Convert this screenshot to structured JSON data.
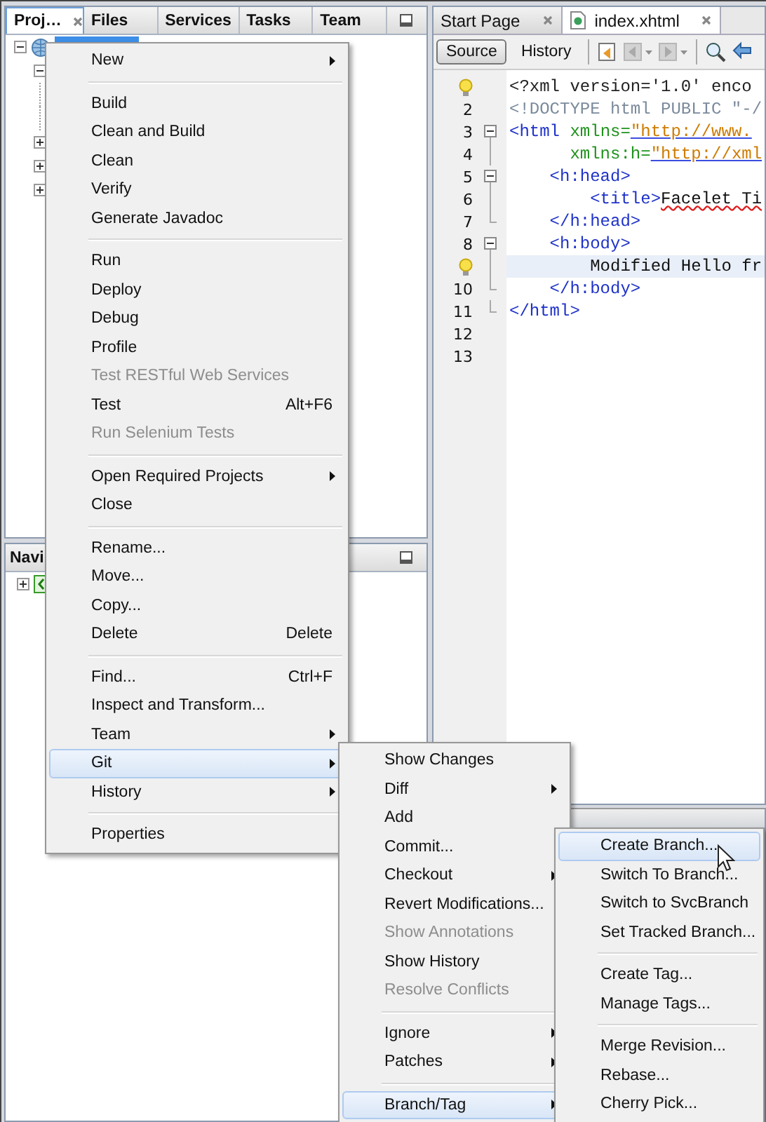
{
  "projects_panel": {
    "tabs": [
      {
        "label": "Proj…",
        "selected": true,
        "closable": true
      },
      {
        "label": "Files",
        "selected": false,
        "closable": false
      },
      {
        "label": "Services",
        "selected": false,
        "closable": false
      },
      {
        "label": "Tasks",
        "selected": false,
        "closable": false
      },
      {
        "label": "Team",
        "selected": false,
        "closable": false
      }
    ],
    "tree": [
      {
        "expanded": true,
        "selected": true,
        "children": [
          {
            "expanded": true,
            "children": [
              {
                "kind": "leaf"
              },
              {
                "kind": "leaf"
              }
            ]
          },
          {
            "expanded": false
          },
          {
            "expanded": false
          },
          {
            "expanded": false
          }
        ]
      }
    ]
  },
  "navigator_panel": {
    "title": "Navi",
    "tree": [
      {
        "expanded": false
      }
    ]
  },
  "editor": {
    "tabs": [
      {
        "label": "Start Page",
        "selected": false,
        "file_icon": false
      },
      {
        "label": "index.xhtml",
        "selected": true,
        "file_icon": true
      }
    ],
    "views": [
      {
        "label": "Source",
        "selected": true
      },
      {
        "label": "History",
        "selected": false
      }
    ],
    "lines": [
      {
        "hint": true,
        "kind": "plain",
        "current": false,
        "segments": [
          {
            "kind": "pi",
            "text": "<?xml version='1.0' enco"
          }
        ]
      },
      {
        "number": "2",
        "hint": false,
        "kind": "plain",
        "current": false,
        "segments": [
          {
            "kind": "doctype",
            "text": "<!DOCTYPE html PUBLIC \"-/"
          }
        ]
      },
      {
        "number": "3",
        "hint": false,
        "kind": "fold-start",
        "current": false,
        "segments": [
          {
            "kind": "tag",
            "text": "<html "
          },
          {
            "kind": "attr",
            "text": "xmlns="
          },
          {
            "kind": "string",
            "text": "\"http://www."
          }
        ]
      },
      {
        "number": "4",
        "hint": false,
        "kind": "fold-line",
        "current": false,
        "segments": [
          {
            "kind": "attr",
            "text": "      xmlns:h="
          },
          {
            "kind": "string",
            "text": "\"http://xml"
          }
        ]
      },
      {
        "number": "5",
        "hint": false,
        "kind": "fold-start",
        "current": false,
        "segments": [
          {
            "kind": "tag",
            "text": "    <h:head>"
          }
        ]
      },
      {
        "number": "6",
        "hint": false,
        "kind": "fold-line",
        "current": false,
        "segments": [
          {
            "kind": "tag",
            "text": "        <title>"
          },
          {
            "kind": "misspelled",
            "text": "Facelet Ti"
          }
        ]
      },
      {
        "number": "7",
        "hint": false,
        "kind": "fold-end",
        "current": false,
        "segments": [
          {
            "kind": "tag",
            "text": "    </h:head>"
          }
        ]
      },
      {
        "number": "8",
        "hint": false,
        "kind": "fold-start",
        "current": false,
        "segments": [
          {
            "kind": "tag",
            "text": "    <h:body>"
          }
        ]
      },
      {
        "hint": true,
        "kind": "fold-line",
        "current": true,
        "segments": [
          {
            "kind": "text",
            "text": "        Modified Hello fr"
          }
        ]
      },
      {
        "number": "10",
        "hint": false,
        "kind": "fold-end",
        "current": false,
        "segments": [
          {
            "kind": "tag",
            "text": "    </h:body>"
          }
        ]
      },
      {
        "number": "11",
        "hint": false,
        "kind": "fold-end",
        "current": false,
        "segments": [
          {
            "kind": "tag",
            "text": "</html>"
          }
        ]
      },
      {
        "number": "12",
        "hint": false,
        "kind": "plain",
        "current": false
      },
      {
        "number": "13",
        "hint": false,
        "kind": "plain",
        "current": false
      }
    ]
  },
  "context_menu": {
    "items": [
      {
        "kind": "item",
        "label": "New",
        "submenu": true,
        "disabled": false,
        "selected": false
      },
      {
        "kind": "separator"
      },
      {
        "kind": "item",
        "label": "Build",
        "submenu": false,
        "disabled": false,
        "selected": false
      },
      {
        "kind": "item",
        "label": "Clean and Build",
        "submenu": false,
        "disabled": false,
        "selected": false
      },
      {
        "kind": "item",
        "label": "Clean",
        "submenu": false,
        "disabled": false,
        "selected": false
      },
      {
        "kind": "item",
        "label": "Verify",
        "submenu": false,
        "disabled": false,
        "selected": false
      },
      {
        "kind": "item",
        "label": "Generate Javadoc",
        "submenu": false,
        "disabled": false,
        "selected": false
      },
      {
        "kind": "separator"
      },
      {
        "kind": "item",
        "label": "Run",
        "submenu": false,
        "disabled": false,
        "selected": false
      },
      {
        "kind": "item",
        "label": "Deploy",
        "submenu": false,
        "disabled": false,
        "selected": false
      },
      {
        "kind": "item",
        "label": "Debug",
        "submenu": false,
        "disabled": false,
        "selected": false
      },
      {
        "kind": "item",
        "label": "Profile",
        "submenu": false,
        "disabled": false,
        "selected": false
      },
      {
        "kind": "item",
        "label": "Test RESTful Web Services",
        "submenu": false,
        "disabled": true,
        "selected": false
      },
      {
        "kind": "item",
        "label": "Test",
        "shortcut": "Alt+F6",
        "submenu": false,
        "disabled": false,
        "selected": false
      },
      {
        "kind": "item",
        "label": "Run Selenium Tests",
        "submenu": false,
        "disabled": true,
        "selected": false
      },
      {
        "kind": "separator"
      },
      {
        "kind": "item",
        "label": "Open Required Projects",
        "submenu": true,
        "disabled": false,
        "selected": false
      },
      {
        "kind": "item",
        "label": "Close",
        "submenu": false,
        "disabled": false,
        "selected": false
      },
      {
        "kind": "separator"
      },
      {
        "kind": "item",
        "label": "Rename...",
        "submenu": false,
        "disabled": false,
        "selected": false
      },
      {
        "kind": "item",
        "label": "Move...",
        "submenu": false,
        "disabled": false,
        "selected": false
      },
      {
        "kind": "item",
        "label": "Copy...",
        "submenu": false,
        "disabled": false,
        "selected": false
      },
      {
        "kind": "item",
        "label": "Delete",
        "shortcut": "Delete",
        "submenu": false,
        "disabled": false,
        "selected": false
      },
      {
        "kind": "separator"
      },
      {
        "kind": "item",
        "label": "Find...",
        "shortcut": "Ctrl+F",
        "submenu": false,
        "disabled": false,
        "selected": false
      },
      {
        "kind": "item",
        "label": "Inspect and Transform...",
        "submenu": false,
        "disabled": false,
        "selected": false
      },
      {
        "kind": "item",
        "label": "Team",
        "submenu": true,
        "disabled": false,
        "selected": false
      },
      {
        "kind": "item",
        "label": "Git",
        "submenu": true,
        "disabled": false,
        "selected": true
      },
      {
        "kind": "item",
        "label": "History",
        "submenu": true,
        "disabled": false,
        "selected": false
      },
      {
        "kind": "separator"
      },
      {
        "kind": "item",
        "label": "Properties",
        "submenu": false,
        "disabled": false,
        "selected": false
      }
    ]
  },
  "git_submenu": {
    "items": [
      {
        "kind": "item",
        "label": "Show Changes",
        "submenu": false,
        "disabled": false,
        "selected": false
      },
      {
        "kind": "item",
        "label": "Diff",
        "submenu": true,
        "disabled": false,
        "selected": false
      },
      {
        "kind": "item",
        "label": "Add",
        "submenu": false,
        "disabled": false,
        "selected": false
      },
      {
        "kind": "item",
        "label": "Commit...",
        "submenu": false,
        "disabled": false,
        "selected": false
      },
      {
        "kind": "item",
        "label": "Checkout",
        "submenu": true,
        "disabled": false,
        "selected": false
      },
      {
        "kind": "item",
        "label": "Revert Modifications...",
        "submenu": false,
        "disabled": false,
        "selected": false
      },
      {
        "kind": "item",
        "label": "Show Annotations",
        "submenu": false,
        "disabled": true,
        "selected": false
      },
      {
        "kind": "item",
        "label": "Show History",
        "submenu": false,
        "disabled": false,
        "selected": false
      },
      {
        "kind": "item",
        "label": "Resolve Conflicts",
        "submenu": false,
        "disabled": true,
        "selected": false
      },
      {
        "kind": "separator"
      },
      {
        "kind": "item",
        "label": "Ignore",
        "submenu": true,
        "disabled": false,
        "selected": false
      },
      {
        "kind": "item",
        "label": "Patches",
        "submenu": true,
        "disabled": false,
        "selected": false
      },
      {
        "kind": "separator"
      },
      {
        "kind": "item",
        "label": "Branch/Tag",
        "submenu": true,
        "disabled": false,
        "selected": true
      }
    ]
  },
  "branch_submenu": {
    "items": [
      {
        "kind": "item",
        "label": "Create Branch...",
        "submenu": false,
        "disabled": false,
        "selected": true
      },
      {
        "kind": "item",
        "label": "Switch To Branch...",
        "submenu": false,
        "disabled": false,
        "selected": false
      },
      {
        "kind": "item",
        "label": "Switch to SvcBranch",
        "submenu": false,
        "disabled": false,
        "selected": false
      },
      {
        "kind": "item",
        "label": "Set Tracked Branch...",
        "submenu": false,
        "disabled": false,
        "selected": false
      },
      {
        "kind": "separator"
      },
      {
        "kind": "item",
        "label": "Create Tag...",
        "submenu": false,
        "disabled": false,
        "selected": false
      },
      {
        "kind": "item",
        "label": "Manage Tags...",
        "submenu": false,
        "disabled": false,
        "selected": false
      },
      {
        "kind": "separator"
      },
      {
        "kind": "item",
        "label": "Merge Revision...",
        "submenu": false,
        "disabled": false,
        "selected": false
      },
      {
        "kind": "item",
        "label": "Rebase...",
        "submenu": false,
        "disabled": false,
        "selected": false
      },
      {
        "kind": "item",
        "label": "Cherry Pick...",
        "submenu": false,
        "disabled": false,
        "selected": false
      }
    ]
  }
}
